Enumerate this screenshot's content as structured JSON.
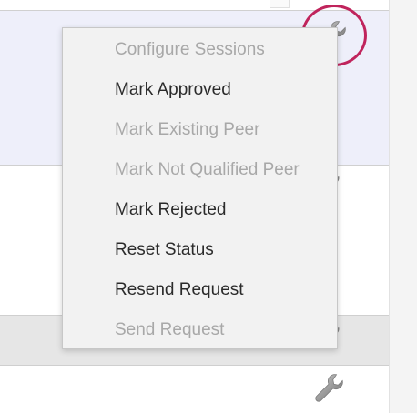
{
  "rows": {
    "selected_row_color": "#eeeffa",
    "header_row_color": "#e6e6e6"
  },
  "action_icon": {
    "icon": "wrench-icon",
    "highlight_color": "#c0245c"
  },
  "context_menu": {
    "items": [
      {
        "label": "Configure Sessions",
        "enabled": false
      },
      {
        "label": "Mark Approved",
        "enabled": true
      },
      {
        "label": "Mark Existing Peer",
        "enabled": false
      },
      {
        "label": "Mark Not Qualified Peer",
        "enabled": false
      },
      {
        "label": "Mark Rejected",
        "enabled": true
      },
      {
        "label": "Reset Status",
        "enabled": true
      },
      {
        "label": "Resend Request",
        "enabled": true
      },
      {
        "label": "Send Request",
        "enabled": false
      }
    ],
    "enabled_color": "#2b2b2b",
    "disabled_color": "#a8a8a8"
  }
}
